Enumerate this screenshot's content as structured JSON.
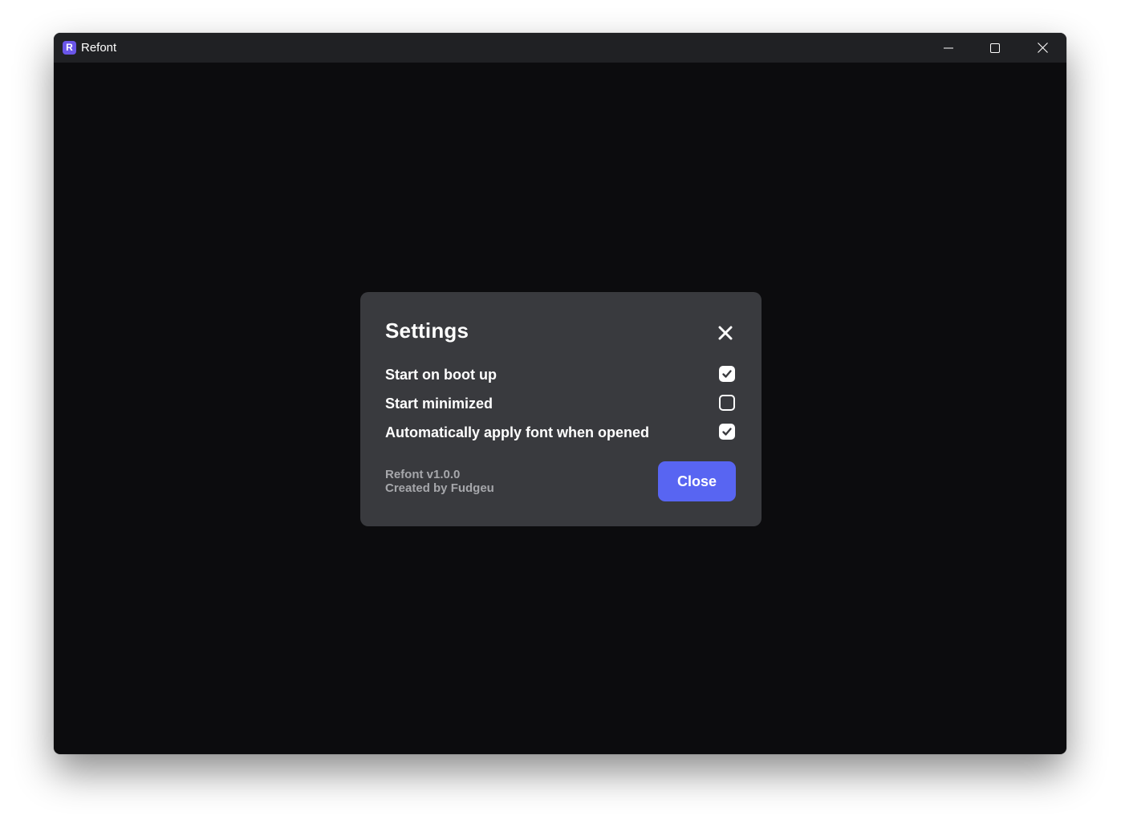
{
  "window": {
    "title": "Refont",
    "app_icon_letter": "R",
    "controls": {
      "minimize_icon": "minimize-icon",
      "maximize_icon": "maximize-icon",
      "close_icon": "close-icon"
    }
  },
  "settings_dialog": {
    "title": "Settings",
    "close_icon": "close-icon",
    "options": [
      {
        "label": "Start on boot up",
        "checked": true
      },
      {
        "label": "Start minimized",
        "checked": false
      },
      {
        "label": "Automatically apply font when opened",
        "checked": true
      }
    ],
    "version_text": "Refont v1.0.0",
    "credit_text": "Created by Fudgeu",
    "close_button_label": "Close"
  },
  "colors": {
    "window_background": "#0c0c0e",
    "titlebar_background": "#202124",
    "dialog_background": "#393a3e",
    "accent": "#5865f2",
    "app_icon": "#6a56e8",
    "muted_text": "#a6a7ab"
  }
}
